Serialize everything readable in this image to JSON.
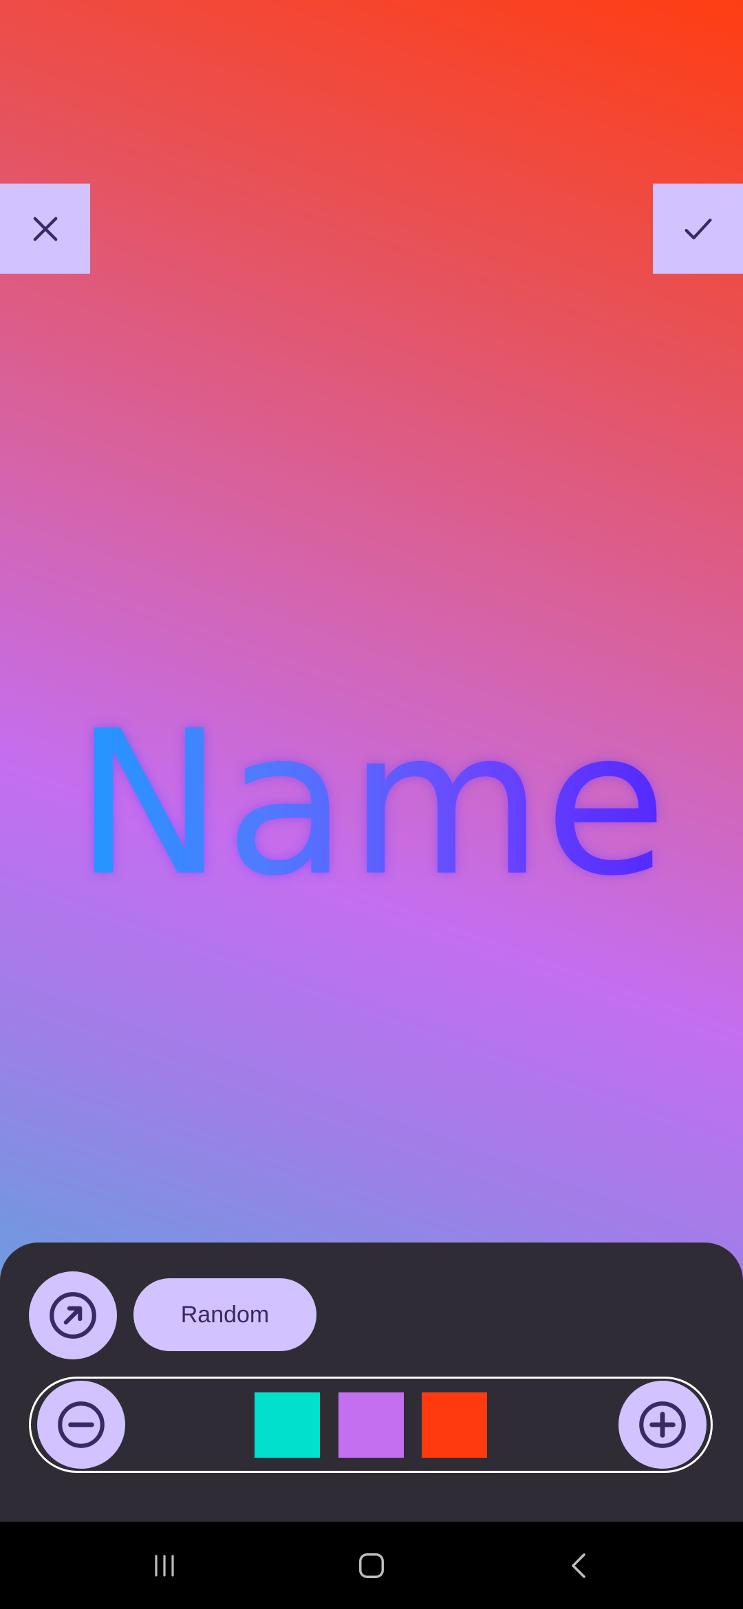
{
  "colors": {
    "button_fill": "#d2c2ff",
    "icon_dark": "#3a2a63",
    "panel_bg": "#2f2c35",
    "swatches": [
      "#00e0cc",
      "#c46ef0",
      "#ff3a0f"
    ]
  },
  "top_bar": {
    "close_icon": "close-icon",
    "confirm_icon": "check-icon"
  },
  "preview": {
    "text": "Name"
  },
  "controls": {
    "random_label": "Random",
    "open_icon": "arrow-up-right-circle-icon",
    "decrease_icon": "minus-circle-icon",
    "increase_icon": "plus-circle-icon"
  },
  "navbar": {
    "recents_icon": "recents-icon",
    "home_icon": "home-icon",
    "back_icon": "back-icon"
  }
}
